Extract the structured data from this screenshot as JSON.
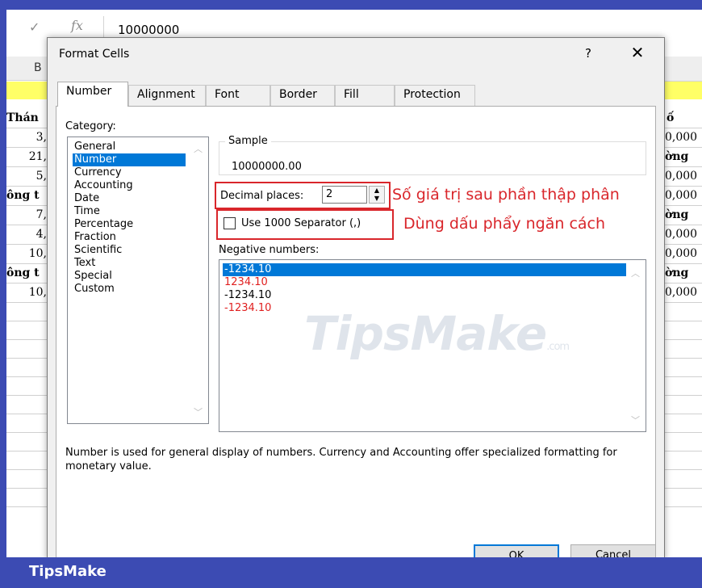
{
  "formula_bar": {
    "cancel_icon": "check-icon",
    "fx_label": "fx",
    "value": "10000000"
  },
  "sheet": {
    "col_header_left": "B",
    "left_cells": [
      "Thán",
      "3,",
      "21,",
      "5,",
      "ông t",
      "7,",
      "4,",
      "10,",
      "ông t",
      "10,"
    ],
    "right_cells": [
      "ố",
      "0,000",
      "ờng",
      "0,000",
      "0,000",
      "ờng",
      "0,000",
      "0,000",
      "ờng",
      "0,000"
    ]
  },
  "dialog": {
    "title": "Format Cells",
    "help": "?",
    "close": "✕",
    "tabs": [
      "Number",
      "Alignment",
      "Font",
      "Border",
      "Fill",
      "Protection"
    ],
    "category_label": "Category:",
    "categories": [
      "General",
      "Number",
      "Currency",
      "Accounting",
      "Date",
      "Time",
      "Percentage",
      "Fraction",
      "Scientific",
      "Text",
      "Special",
      "Custom"
    ],
    "selected_category": "Number",
    "sample_label": "Sample",
    "sample_value": "10000000.00",
    "decimal_label": "Decimal places:",
    "decimal_value": "2",
    "separator_label": "Use 1000 Separator (,)",
    "separator_checked": false,
    "negative_label": "Negative numbers:",
    "negative_options": [
      "-1234.10",
      "1234.10",
      "-1234.10",
      "-1234.10"
    ],
    "description": "Number is used for general display of numbers.  Currency and Accounting offer specialized formatting for monetary value.",
    "ok_label": "OK",
    "cancel_label": "Cancel"
  },
  "annotations": {
    "decimal_note": "Số giá trị sau phần thập phân",
    "separator_note": "Dùng dấu phẩy ngăn cách"
  },
  "watermark": {
    "text": "TipsMake",
    "suffix": ".com"
  },
  "brand": {
    "name": "TipsMake"
  },
  "colors": {
    "frame": "#3c4bb3",
    "selection": "#0078d7",
    "annotation": "#d9262b",
    "negative_red": "#e02020"
  }
}
